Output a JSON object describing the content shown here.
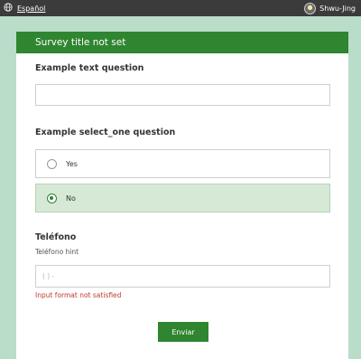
{
  "topbar": {
    "language_label": "Español",
    "user_name": "Shwu-Jing"
  },
  "survey": {
    "title": "Survey title not set",
    "q1": {
      "label": "Example text question",
      "value": ""
    },
    "q2": {
      "label": "Example select_one question",
      "options": [
        {
          "label": "Yes",
          "selected": false
        },
        {
          "label": "No",
          "selected": true
        }
      ]
    },
    "q3": {
      "label": "Teléfono",
      "hint": "Teléfono hint",
      "placeholder": "(  )  -",
      "error": "Input format not satisfied"
    },
    "submit_label": "Enviar"
  },
  "colors": {
    "brand": "#2f8530",
    "selected_bg": "#d6e9d6",
    "page_bg": "#b9ddc9",
    "error": "#c0392b"
  },
  "icons": {
    "language": "globe-icon",
    "user": "avatar"
  }
}
